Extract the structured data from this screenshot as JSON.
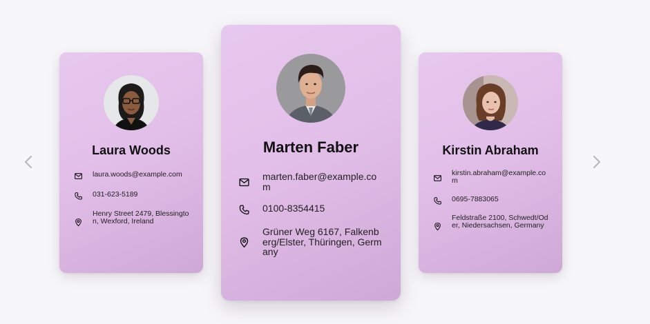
{
  "carousel": {
    "prev_icon": "chevron-left-icon",
    "next_icon": "chevron-right-icon",
    "cards": [
      {
        "name": "Laura Woods",
        "email": "laura.woods@example.com",
        "phone": "031-623-5189",
        "address": "Henry Street 2479, Blessington, Wexford, Ireland"
      },
      {
        "name": "Marten Faber",
        "email": "marten.faber@example.com",
        "phone": "0100-8354415",
        "address": "Grüner Weg 6167, Falkenberg/Elster, Thüringen, Germany"
      },
      {
        "name": "Kirstin Abraham",
        "email": "kirstin.abraham@example.com",
        "phone": "0695-7883065",
        "address": "Feldstraße 2100, Schwedt/Oder, Niedersachsen, Germany"
      }
    ]
  },
  "colors": {
    "card_gradient_start": "#e7c8ee",
    "card_gradient_end": "#cfa9d6",
    "background": "#f7f7f9",
    "nav_arrow": "#b9b9bd"
  }
}
